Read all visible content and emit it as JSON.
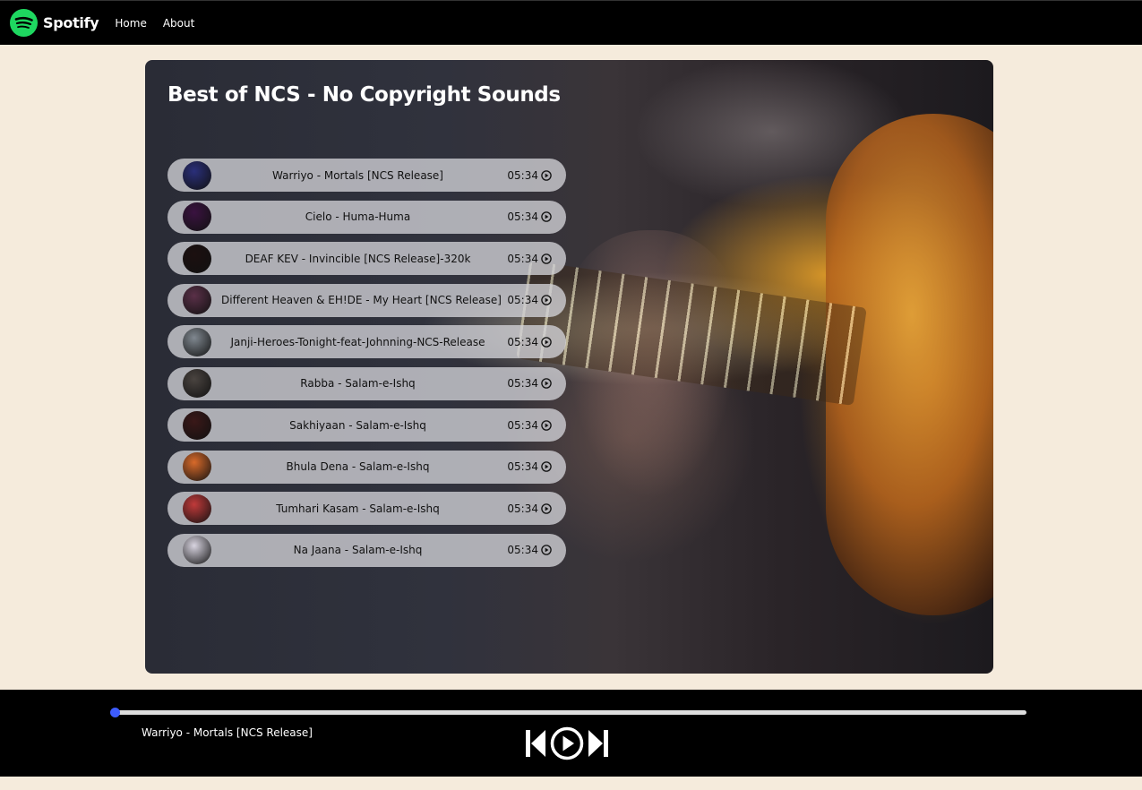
{
  "navbar": {
    "brand": "Spotify",
    "links": [
      "Home",
      "About"
    ]
  },
  "playlist": {
    "title": "Best of NCS - No Copyright Sounds",
    "songs": [
      {
        "name": "Warriyo - Mortals [NCS Release]",
        "duration": "05:34",
        "cover_color": "#2a2f7a"
      },
      {
        "name": "Cielo - Huma-Huma",
        "duration": "05:34",
        "cover_color": "#3a1240"
      },
      {
        "name": "DEAF KEV - Invincible [NCS Release]-320k",
        "duration": "05:34",
        "cover_color": "#1c1010"
      },
      {
        "name": "Different Heaven & EH!DE - My Heart [NCS Release]",
        "duration": "05:34",
        "cover_color": "#5a3048"
      },
      {
        "name": "Janji-Heroes-Tonight-feat-Johnning-NCS-Release",
        "duration": "05:34",
        "cover_color": "#808890"
      },
      {
        "name": "Rabba - Salam-e-Ishq",
        "duration": "05:34",
        "cover_color": "#4a4440"
      },
      {
        "name": "Sakhiyaan - Salam-e-Ishq",
        "duration": "05:34",
        "cover_color": "#3a1818"
      },
      {
        "name": "Bhula Dena - Salam-e-Ishq",
        "duration": "05:34",
        "cover_color": "#d86a2a"
      },
      {
        "name": "Tumhari Kasam - Salam-e-Ishq",
        "duration": "05:34",
        "cover_color": "#c03a3a"
      },
      {
        "name": "Na Jaana - Salam-e-Ishq",
        "duration": "05:34",
        "cover_color": "#d8d4e0"
      }
    ]
  },
  "player": {
    "now_playing": "Warriyo - Mortals [NCS Release]",
    "progress": 0,
    "controls": [
      "previous-icon",
      "play-icon",
      "next-icon"
    ],
    "accent": "#3d5cff"
  },
  "colors": {
    "background": "#f5ebdc",
    "brand_green": "#1ed760"
  }
}
